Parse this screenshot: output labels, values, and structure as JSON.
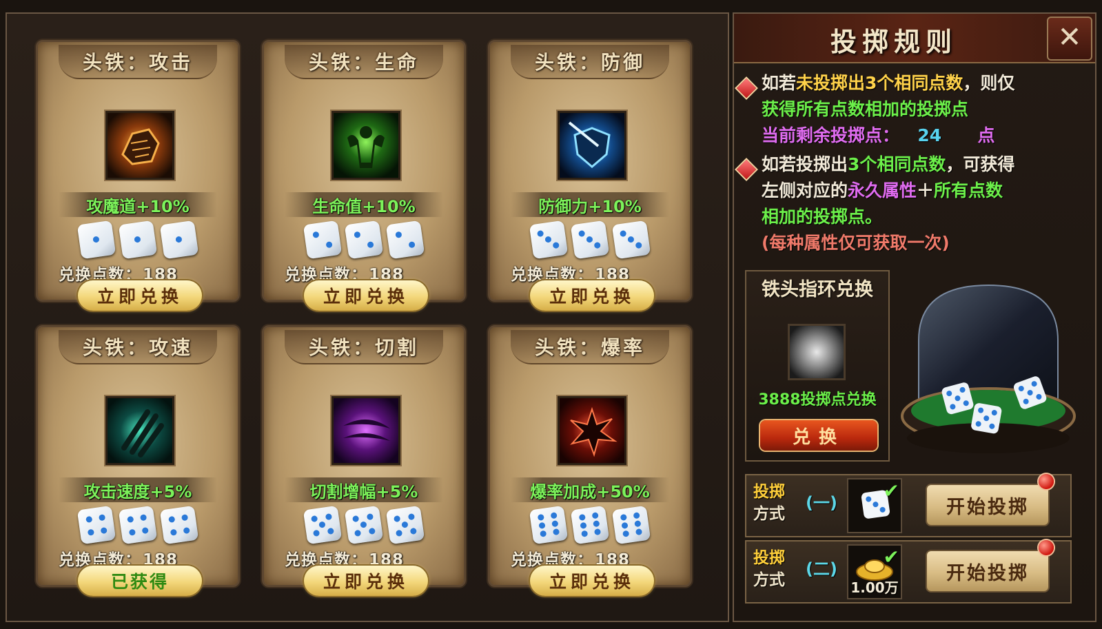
{
  "cards": [
    {
      "title": "头铁：攻击",
      "bonus": "攻魔道+10%",
      "cost_label": "兑换点数：",
      "cost": "188",
      "button": "立即兑换",
      "obtained": false,
      "icon": "fist-icon",
      "dice_face": 1
    },
    {
      "title": "头铁：生命",
      "bonus": "生命值+10%",
      "cost_label": "兑换点数：",
      "cost": "188",
      "button": "立即兑换",
      "obtained": false,
      "icon": "muscle-icon",
      "dice_face": 2
    },
    {
      "title": "头铁：防御",
      "bonus": "防御力+10%",
      "cost_label": "兑换点数：",
      "cost": "188",
      "button": "立即兑换",
      "obtained": false,
      "icon": "shield-icon",
      "dice_face": 3
    },
    {
      "title": "头铁：攻速",
      "bonus": "攻击速度+5%",
      "cost_label": "兑换点数：",
      "cost": "188",
      "button": "已获得",
      "obtained": true,
      "icon": "claw-slash-icon",
      "dice_face": 4
    },
    {
      "title": "头铁：切割",
      "bonus": "切割增幅+5%",
      "cost_label": "兑换点数：",
      "cost": "188",
      "button": "立即兑换",
      "obtained": false,
      "icon": "purple-slash-icon",
      "dice_face": 5
    },
    {
      "title": "头铁：爆率",
      "bonus": "爆率加成+50%",
      "cost_label": "兑换点数：",
      "cost": "188",
      "button": "立即兑换",
      "obtained": false,
      "icon": "burst-icon",
      "dice_face": 6
    }
  ],
  "rules": {
    "title": "投掷规则",
    "close": "✕",
    "rule1": {
      "a": "如若",
      "b": "未投掷出3个相同点数",
      "c": "，则仅",
      "d": "获得所有点数相加的投掷点"
    },
    "remaining": {
      "label": "当前剩余投掷点：",
      "value": "24",
      "unit": "点"
    },
    "rule2": {
      "a": "如若投掷出",
      "b": "3个相同点数",
      "c": "，可获得",
      "d": "左侧对应的",
      "e": "永久属性",
      "f": "＋",
      "g": "所有点数",
      "h": "相加的投掷点。"
    },
    "note": "(每种属性仅可获取一次)"
  },
  "ring": {
    "title": "铁头指环兑换",
    "cost": "3888投掷点兑换",
    "button": "兑换"
  },
  "throws": [
    {
      "label_a": "投掷",
      "label_b": "方式",
      "num": "(一)",
      "button": "开始投掷",
      "amount": ""
    },
    {
      "label_a": "投掷",
      "label_b": "方式",
      "num": "(二)",
      "button": "开始投掷",
      "amount": "1.00万"
    }
  ],
  "colors": {
    "green_text": "#6cf04a",
    "yellow_text": "#ffd24a",
    "purple_text": "#e06cf0",
    "cyan_text": "#58d2ee",
    "button_gold": "#f3d77a",
    "button_red": "#b9280d"
  }
}
